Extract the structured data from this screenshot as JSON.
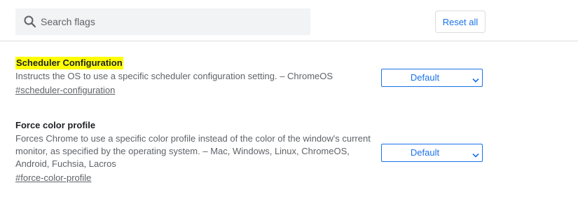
{
  "search": {
    "placeholder": "Search flags",
    "icon": "search-icon"
  },
  "toolbar": {
    "reset_label": "Reset all"
  },
  "flags": [
    {
      "title": "Scheduler Configuration",
      "highlighted": true,
      "description": "Instructs the OS to use a specific scheduler configuration setting. – ChromeOS",
      "link": "#scheduler-configuration",
      "selected": "Default"
    },
    {
      "title": "Force color profile",
      "highlighted": false,
      "description": "Forces Chrome to use a specific color profile instead of the color of the window's current monitor, as specified by the operating system. – Mac, Windows, Linux, ChromeOS, Android, Fuchsia, Lacros",
      "link": "#force-color-profile",
      "selected": "Default"
    }
  ],
  "colors": {
    "accent": "#1a73e8",
    "highlight": "#ffff00",
    "search_bg": "#f1f3f4"
  }
}
